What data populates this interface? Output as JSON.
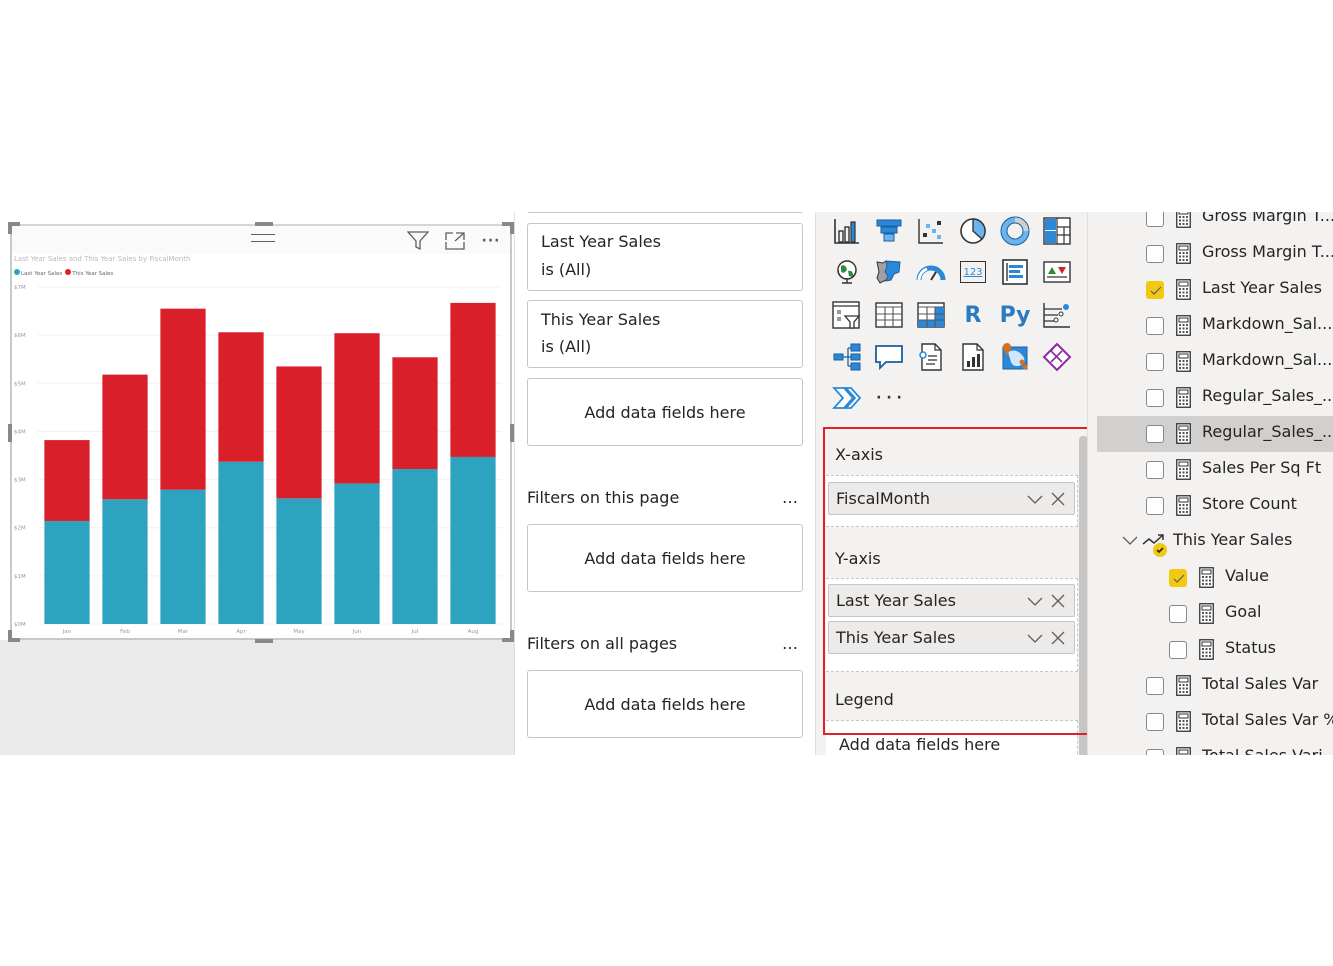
{
  "visual": {
    "header_icons": [
      "filter-icon",
      "focus-mode-icon",
      "more-options-icon"
    ],
    "more_label": "···"
  },
  "chart_data": {
    "type": "bar",
    "stacked": true,
    "title": "Last Year Sales and This Year Sales by FiscalMonth",
    "xlabel": "",
    "ylabel": "",
    "categories": [
      "Jan",
      "Feb",
      "Mar",
      "Apr",
      "May",
      "Jun",
      "Jul",
      "Aug"
    ],
    "series": [
      {
        "name": "Last Year Sales",
        "color": "#2ea3bf",
        "values": [
          2.14,
          2.59,
          2.79,
          3.37,
          2.61,
          2.92,
          3.22,
          3.47
        ]
      },
      {
        "name": "This Year Sales",
        "color": "#d91f2a",
        "values": [
          1.68,
          2.59,
          3.76,
          2.69,
          2.74,
          3.12,
          2.32,
          3.2
        ]
      }
    ],
    "units": "$M",
    "ylim": [
      0,
      7
    ],
    "yticks": [
      "$0M",
      "$1M",
      "$2M",
      "$3M",
      "$4M",
      "$5M",
      "$6M",
      "$7M"
    ],
    "grid": true,
    "legend": "top-left"
  },
  "filters": {
    "visual_filters": [
      {
        "field": "Last Year Sales",
        "condition": "is (All)"
      },
      {
        "field": "This Year Sales",
        "condition": "is (All)"
      }
    ],
    "add_fields_label": "Add data fields here",
    "page_section": {
      "title": "Filters on this page",
      "more": "…",
      "add_label": "Add data fields here"
    },
    "all_pages_section": {
      "title": "Filters on all pages",
      "more": "…",
      "add_label": "Add data fields here"
    }
  },
  "visualizations": {
    "icons": [
      "stacked-column-chart-icon",
      "funnel-icon",
      "scatter-chart-icon",
      "pie-chart-icon",
      "donut-chart-icon",
      "treemap-icon",
      "map-icon",
      "filled-map-icon",
      "gauge-icon",
      "card-icon",
      "multi-row-card-icon",
      "kpi-icon",
      "slicer-icon",
      "table-icon",
      "matrix-icon",
      "r-script-visual-icon",
      "python-visual-icon",
      "key-influencers-icon",
      "decomposition-tree-icon",
      "qa-icon",
      "smart-narrative-icon",
      "paginated-report-icon",
      "arcgis-map-icon",
      "power-apps-icon",
      "power-automate-icon",
      "more-visuals-icon"
    ],
    "r_label": "R",
    "py_label": "Py",
    "card_label": "123",
    "more_label": "· · ·",
    "wells": {
      "x_axis": {
        "label": "X-axis",
        "fields": [
          "FiscalMonth"
        ]
      },
      "y_axis": {
        "label": "Y-axis",
        "fields": [
          "Last Year Sales",
          "This Year Sales"
        ]
      },
      "legend": {
        "label": "Legend",
        "placeholder": "Add data fields here"
      }
    }
  },
  "fields": {
    "items": [
      {
        "label": "Gross Margin T...",
        "checked": false
      },
      {
        "label": "Gross Margin T...",
        "checked": false
      },
      {
        "label": "Last Year Sales",
        "checked": true
      },
      {
        "label": "Markdown_Sal...",
        "checked": false
      },
      {
        "label": "Markdown_Sal...",
        "checked": false
      },
      {
        "label": "Regular_Sales_...",
        "checked": false
      },
      {
        "label": "Regular_Sales_...",
        "checked": false,
        "hovered": true
      },
      {
        "label": "Sales Per Sq Ft",
        "checked": false
      },
      {
        "label": "Store Count",
        "checked": false
      }
    ],
    "kpi_group": {
      "label": "This Year Sales",
      "expanded": true,
      "children": [
        {
          "label": "Value",
          "checked": true
        },
        {
          "label": "Goal",
          "checked": false
        },
        {
          "label": "Status",
          "checked": false
        }
      ]
    },
    "items_after": [
      {
        "label": "Total Sales Var",
        "checked": false
      },
      {
        "label": "Total Sales Var %",
        "checked": false
      },
      {
        "label": "Total Sales Vari...",
        "checked": false
      }
    ]
  },
  "colors": {
    "last_year": "#2ea3bf",
    "this_year": "#d91f2a",
    "highlight_box": "#e0202a",
    "checkbox_checked": "#f2c811",
    "icon_blue": "#2b88d8"
  }
}
